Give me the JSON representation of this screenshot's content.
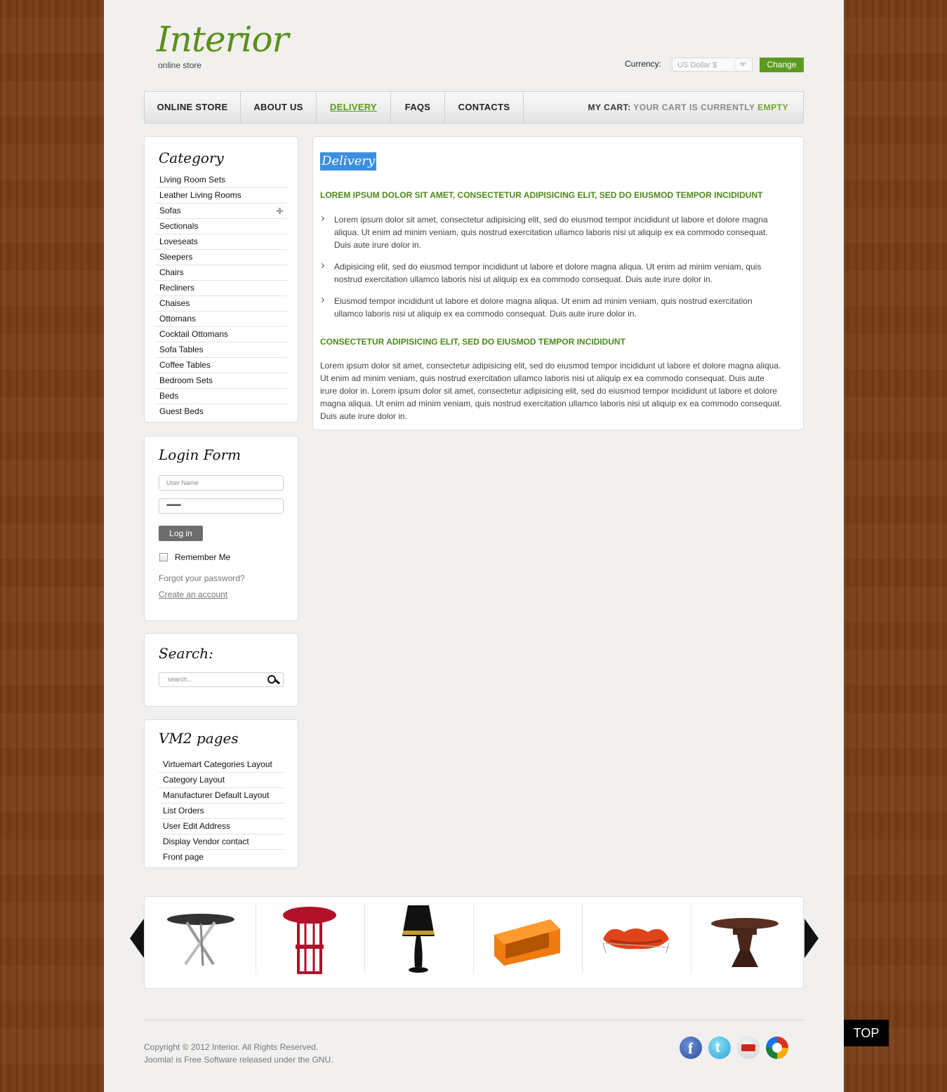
{
  "header": {
    "logo_title": "Interior",
    "logo_subtitle": "online store",
    "currency_label": "Currency:",
    "currency_value": "US Dollar $",
    "change_button": "Change"
  },
  "nav": {
    "items": [
      {
        "label": "ONLINE STORE"
      },
      {
        "label": "ABOUT US"
      },
      {
        "label": "DELIVERY"
      },
      {
        "label": "FAQS"
      },
      {
        "label": "CONTACTS"
      }
    ],
    "cart_label": "MY CART:",
    "cart_message": "YOUR CART IS CURRENTLY",
    "cart_status": "EMPTY"
  },
  "category": {
    "title": "Category",
    "items": [
      "Living Room Sets",
      "Leather Living Rooms",
      "Sofas",
      "Sectionals",
      "Loveseats",
      "Sleepers",
      "Chairs",
      "Recliners",
      "Chaises",
      "Ottomans",
      "Cocktail Ottomans",
      "Sofa Tables",
      "Coffee Tables",
      "Bedroom Sets",
      "Beds",
      "Guest Beds"
    ]
  },
  "login": {
    "title": "Login Form",
    "username_placeholder": "User Name",
    "password_value": "••••••••",
    "login_button": "Log in",
    "remember_label": "Remember Me",
    "forgot_link": "Forgot your password?",
    "create_link": "Create an account"
  },
  "search": {
    "title": "Search:",
    "placeholder": "search..."
  },
  "vm2": {
    "title": "VM2 pages",
    "items": [
      "Virtuemart Categories Layout",
      "Category Layout",
      "Manufacturer Default Layout",
      "List Orders",
      "User Edit Address",
      "Display Vendor contact",
      "Front page"
    ]
  },
  "content": {
    "title": "Delivery",
    "heading1": "LOREM IPSUM DOLOR SIT AMET, CONSECTETUR ADIPISICING ELIT, SED DO EIUSMOD TEMPOR INCIDIDUNT",
    "bullets": [
      "Lorem ipsum dolor sit amet, consectetur adipisicing elit, sed do eiusmod tempor incididunt ut labore et dolore magna aliqua. Ut enim ad minim veniam, quis nostrud exercitation ullamco laboris nisi ut aliquip ex ea commodo consequat. Duis aute irure dolor in.",
      "Adipisicing elit, sed do eiusmod tempor incididunt ut labore et dolore magna aliqua. Ut enim ad minim veniam, quis nostrud exercitation ullamco laboris nisi ut aliquip ex ea commodo consequat. Duis aute irure dolor in.",
      "Eiusmod tempor incididunt ut labore et dolore magna aliqua. Ut enim ad minim veniam, quis nostrud exercitation ullamco laboris nisi ut aliquip ex ea commodo consequat. Duis aute irure dolor in."
    ],
    "heading2": "CONSECTETUR ADIPISICING ELIT, SED DO EIUSMOD TEMPOR INCIDIDUNT",
    "paragraph": "Lorem ipsum dolor sit amet, consectetur adipisicing elit, sed do eiusmod tempor incididunt ut labore et dolore magna aliqua. Ut enim ad minim veniam, quis nostrud exercitation ullamco laboris nisi ut aliquip ex ea commodo consequat. Duis aute irure dolor in. Lorem ipsum dolor sit amet, consectetur adipisicing elit, sed do eiusmod tempor incididunt ut labore et dolore magna aliqua. Ut enim ad minim veniam, quis nostrud exercitation ullamco laboris nisi ut aliquip ex ea commodo consequat. Duis aute irure dolor in."
  },
  "carousel": {
    "items": [
      "glass-table-icon",
      "red-stool-icon",
      "black-lamp-icon",
      "orange-box-table-icon",
      "orange-sofa-icon",
      "brown-table-icon"
    ]
  },
  "footer": {
    "copyright": "Copyright © 2012 Interior. All Rights Reserved.",
    "license": "Joomla! is Free Software released under the GNU.",
    "social": [
      "facebook-icon",
      "twitter-icon",
      "youtube-icon",
      "google-icon"
    ],
    "top_button": "TOP"
  },
  "colors": {
    "accent_green": "#5c9a20",
    "title_highlight": "#3b8fe0",
    "wood_background": "#7a3d16"
  }
}
